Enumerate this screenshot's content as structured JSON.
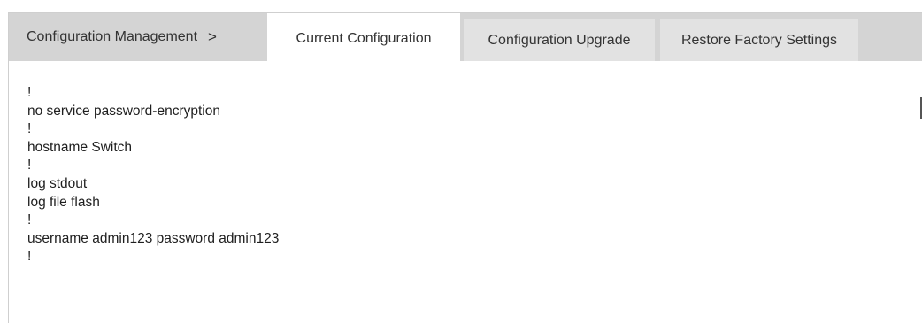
{
  "breadcrumb": {
    "label": "Configuration Management",
    "separator": ">"
  },
  "tabs": [
    {
      "label": "Current Configuration",
      "active": true
    },
    {
      "label": "Configuration Upgrade",
      "active": false
    },
    {
      "label": "Restore Factory Settings",
      "active": false
    }
  ],
  "config_lines": [
    "!",
    "no service password-encryption",
    "!",
    "hostname Switch",
    "!",
    "log stdout",
    "log file flash",
    "!",
    "username admin123 password admin123",
    "!"
  ],
  "colors": {
    "tabbar_bg": "#d4d4d4",
    "inactive_tab_bg": "#e2e2e2",
    "active_tab_bg": "#ffffff"
  }
}
